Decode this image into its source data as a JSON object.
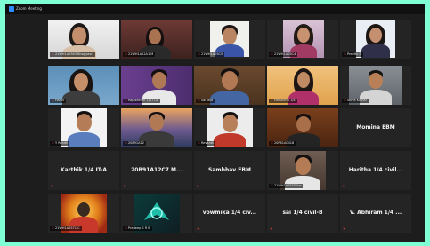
{
  "window": {
    "title": "Zoom Meeting"
  },
  "participants": [
    {
      "name": "21WH1A0563 Bhagyasri",
      "muted": true
    },
    {
      "name": "21WH1A12A1 M",
      "muted": true
    },
    {
      "name": "21WH1A05C5",
      "muted": true
    },
    {
      "name": "21WH1A05C4",
      "muted": true
    },
    {
      "name": "Preethi S",
      "muted": true
    },
    {
      "name": "Harini",
      "muted": true
    },
    {
      "name": "Rajasekhar 1/4 IT-A",
      "muted": true
    },
    {
      "name": "Sai Teja",
      "muted": true
    },
    {
      "name": "Harshitha 1/4",
      "muted": true
    },
    {
      "name": "Shiva Kumar",
      "muted": true
    },
    {
      "name": "Y Rohith",
      "muted": true
    },
    {
      "name": "20891A12",
      "muted": true
    },
    {
      "name": "Revanth",
      "muted": true
    },
    {
      "name": "20P61A0418",
      "muted": true
    },
    {
      "name": "Momina EBM",
      "muted": false
    },
    {
      "name": "Karthik 1/4 IT-A",
      "muted": true
    },
    {
      "name": "20B91A12C7 M...",
      "muted": true
    },
    {
      "name": "Sambhav EBM",
      "muted": true
    },
    {
      "name": "21WH1A0533 Sai",
      "muted": true
    },
    {
      "name": "Haritha 1/4 civil...",
      "muted": true
    },
    {
      "name": "21WH1A0571 C",
      "muted": true
    },
    {
      "name": "Pradeep S R B",
      "muted": true
    },
    {
      "name": "vowmika 1/4 civ...",
      "muted": true
    },
    {
      "name": "sai 1/4 civil-B",
      "muted": true
    },
    {
      "name": "V. Abhiram 1/4 ...",
      "muted": true
    }
  ]
}
